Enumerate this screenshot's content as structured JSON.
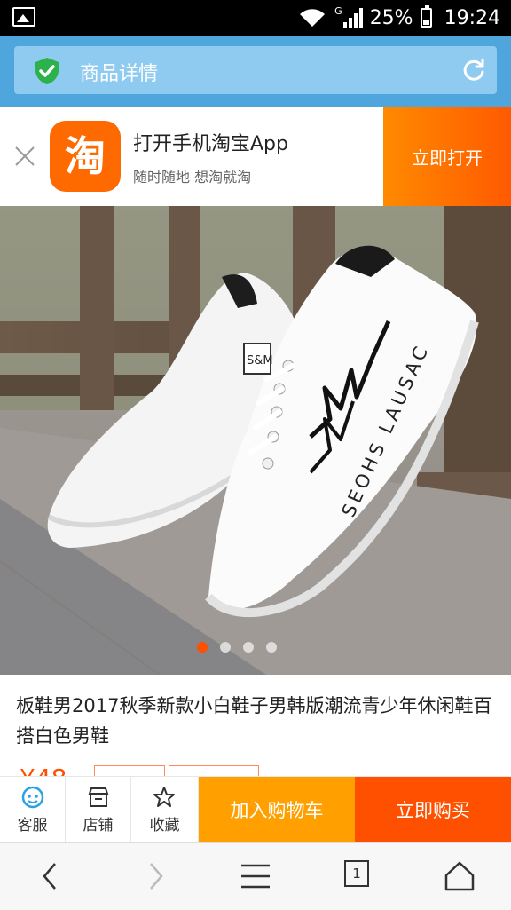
{
  "status_bar": {
    "network_type": "G",
    "battery": "25%",
    "time": "19:24"
  },
  "header": {
    "title": "商品详情"
  },
  "app_banner": {
    "title": "打开手机淘宝App",
    "subtitle": "随时随地 想淘就淘",
    "logo_text": "淘",
    "open_button": "立即打开"
  },
  "gallery": {
    "image_count": 4,
    "active_index": 0,
    "shoe_text": "SEOHS LAUSAC",
    "shoe_badge": "S&M"
  },
  "product": {
    "title": "板鞋男2017秋季新款小白鞋子男韩版潮流青少年休闲鞋百搭白色男鞋",
    "price": "¥48"
  },
  "actions": {
    "service": "客服",
    "shop": "店铺",
    "favorite": "收藏",
    "add_to_cart": "加入购物车",
    "buy_now": "立即购买"
  },
  "browser_nav": {
    "tab_count": "1"
  },
  "colors": {
    "accent": "#ff5000",
    "cart": "#ffa000",
    "header": "#4fa6dd",
    "service_icon": "#2aa0e8"
  }
}
